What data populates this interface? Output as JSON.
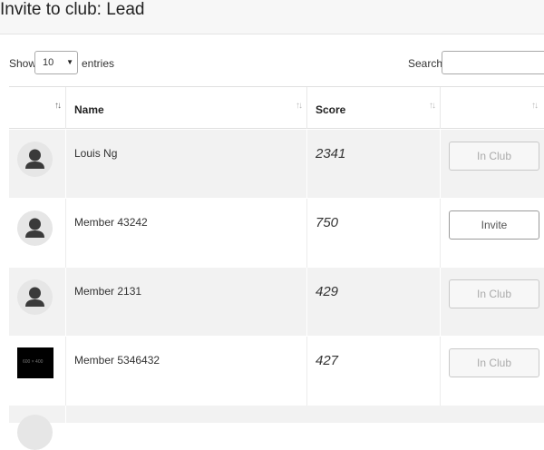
{
  "page": {
    "title": "Invite to club: Lead"
  },
  "controls": {
    "show_label": "Show",
    "entries_value": "10",
    "entries_label": "entries",
    "search_label": "Search:",
    "search_value": ""
  },
  "table": {
    "columns": [
      {
        "label": "",
        "sort": "↑↓"
      },
      {
        "label": "Name",
        "sort": "↑↓"
      },
      {
        "label": "Score",
        "sort": "↑↓"
      },
      {
        "label": "",
        "sort": "↑↓"
      }
    ],
    "rows": [
      {
        "avatar": "user-avatar-icon",
        "name": "Louis Ng",
        "score": "2341",
        "action": "In Club",
        "action_enabled": false
      },
      {
        "avatar": "user-avatar-icon",
        "name": "Member 43242",
        "score": "750",
        "action": "Invite",
        "action_enabled": true
      },
      {
        "avatar": "user-avatar-icon",
        "name": "Member 2131",
        "score": "429",
        "action": "In Club",
        "action_enabled": false
      },
      {
        "avatar": "placeholder-image",
        "avatar_text": "600 × 400",
        "name": "Member 5346432",
        "score": "427",
        "action": "In Club",
        "action_enabled": false
      }
    ]
  }
}
